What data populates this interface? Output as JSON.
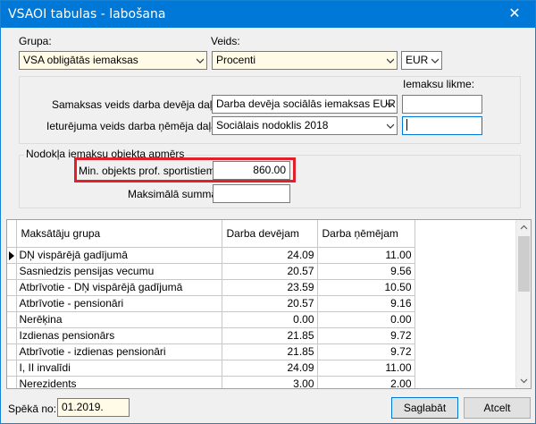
{
  "window": {
    "title": "VSAOI tabulas - labošana",
    "close_glyph": "✕"
  },
  "top": {
    "grupa_label": "Grupa:",
    "grupa_value": "VSA obligātās iemaksas",
    "veids_label": "Veids:",
    "veids_value": "Procenti",
    "currency_value": "EUR"
  },
  "rates": {
    "iemaksu_likme_label": "Iemaksu likme:",
    "employer_label": "Samaksas veids darba devēja daļai:",
    "employer_value": "Darba devēja sociālās iemaksas EUR",
    "employer_rate": "",
    "employee_label": "Ieturējuma veids darba ņēmēja daļai:",
    "employee_value": "Sociālais nodoklis 2018",
    "employee_rate": ""
  },
  "base": {
    "group_title": "Nodokļa iemaksu objekta apmērs",
    "min_label": "Min. objekts prof. sportistiem:",
    "min_value": "860.00",
    "max_label": "Maksimālā summa:",
    "max_value": ""
  },
  "grid": {
    "columns": [
      "Maksātāju grupa",
      "Darba devējam",
      "Darba ņēmējam"
    ],
    "rows": [
      {
        "group": "DŅ vispārējā gadījumā",
        "employer": "24.09",
        "employee": "11.00"
      },
      {
        "group": "Sasniedzis pensijas vecumu",
        "employer": "20.57",
        "employee": "9.56"
      },
      {
        "group": "Atbrīvotie - DŅ vispārējā gadījumā",
        "employer": "23.59",
        "employee": "10.50"
      },
      {
        "group": "Atbrīvotie - pensionāri",
        "employer": "20.57",
        "employee": "9.16"
      },
      {
        "group": "Nerēķina",
        "employer": "0.00",
        "employee": "0.00"
      },
      {
        "group": "Izdienas pensionārs",
        "employer": "21.85",
        "employee": "9.72"
      },
      {
        "group": "Atbrīvotie - izdienas pensionāri",
        "employer": "21.85",
        "employee": "9.72"
      },
      {
        "group": "I, II invalīdi",
        "employer": "24.09",
        "employee": "11.00"
      },
      {
        "group": "Nerezidents",
        "employer": "3.00",
        "employee": "2.00"
      }
    ]
  },
  "footer": {
    "speka_label": "Spēkā no:",
    "speka_value": "01.2019.",
    "save_label": "Saglabāt",
    "cancel_label": "Atcelt"
  }
}
